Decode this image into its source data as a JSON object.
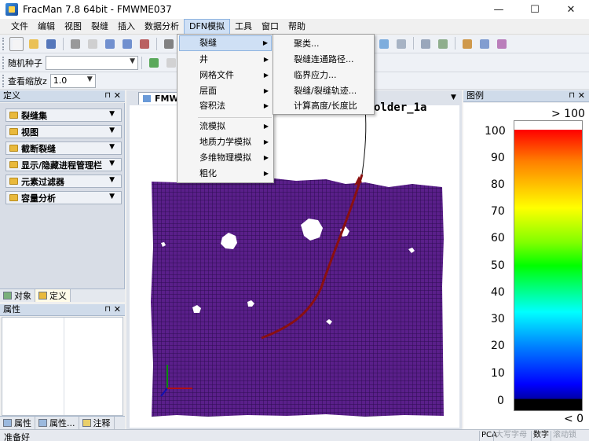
{
  "window": {
    "title": "FracMan 7.8 64bit - FMWME037",
    "minimize": "—",
    "maximize": "☐",
    "close": "✕"
  },
  "menubar": {
    "items": [
      "文件",
      "编辑",
      "视图",
      "裂缝",
      "插入",
      "数据分析",
      "DFN模拟",
      "工具",
      "窗口",
      "帮助"
    ]
  },
  "toolbar": {
    "seed_label": "随机种子",
    "seed_value": "",
    "zoom_label": "查看缩放z",
    "zoom_value": "1.0"
  },
  "define_panel": {
    "title": "定义",
    "items": [
      "裂缝集",
      "视图",
      "截断裂缝",
      "显示/隐藏进程管理栏",
      "元素过滤器",
      "容量分析"
    ],
    "tabs": [
      "对象",
      "定义"
    ]
  },
  "properties_panel": {
    "title": "属性",
    "tabs": [
      "属性",
      "属性...",
      "注释"
    ]
  },
  "view": {
    "tab_label": "FMW",
    "canvas_title": "older_1a"
  },
  "legend": {
    "title": "图例",
    "top_label": "> 100",
    "bottom_label": "< 0",
    "ticks": [
      "100",
      "90",
      "80",
      "70",
      "60",
      "50",
      "40",
      "30",
      "20",
      "10",
      "0"
    ]
  },
  "dfn_menu": {
    "items": [
      "裂缝",
      "井",
      "网格文件",
      "层面",
      "容积法",
      "流模拟",
      "地质力学模拟",
      "多维物理模拟",
      "粗化"
    ]
  },
  "fracture_submenu": {
    "items": [
      "聚类...",
      "裂缝连通路径...",
      "临界应力...",
      "裂缝/裂缝轨迹...",
      "计算高度/长度比"
    ]
  },
  "statusbar": {
    "ready": "准备好",
    "indicators": [
      "PCA",
      "大写字母",
      "数字",
      "滚动锁"
    ]
  }
}
